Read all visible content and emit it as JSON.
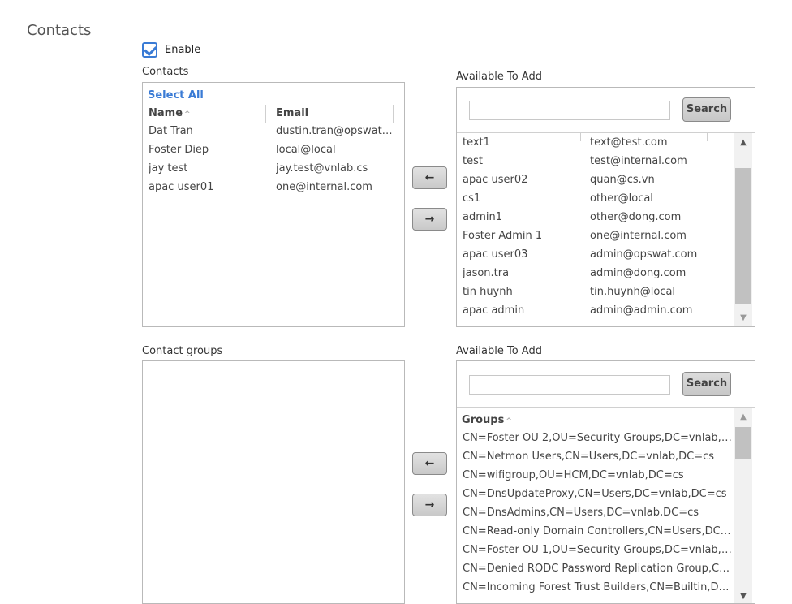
{
  "page": {
    "title": "Contacts"
  },
  "enable": {
    "label": "Enable",
    "checked": true
  },
  "contacts": {
    "label": "Contacts",
    "select_all": "Select All",
    "columns": {
      "name": "Name",
      "email": "Email"
    },
    "sort_icon": "sort-asc-icon",
    "rows": [
      {
        "name": "Dat Tran",
        "email": "dustin.tran@opswat...."
      },
      {
        "name": "Foster Diep",
        "email": "local@local"
      },
      {
        "name": "jay test",
        "email": "jay.test@vnlab.cs"
      },
      {
        "name": "apac user01",
        "email": "one@internal.com"
      }
    ]
  },
  "available_contacts": {
    "label": "Available To Add",
    "search_placeholder": "",
    "search_button": "Search",
    "rows": [
      {
        "name": "text1",
        "email": "text@test.com"
      },
      {
        "name": "test",
        "email": "test@internal.com"
      },
      {
        "name": "apac user02",
        "email": "quan@cs.vn"
      },
      {
        "name": "cs1",
        "email": "other@local"
      },
      {
        "name": "admin1",
        "email": "other@dong.com"
      },
      {
        "name": "Foster Admin 1",
        "email": "one@internal.com"
      },
      {
        "name": "apac user03",
        "email": "admin@opswat.com"
      },
      {
        "name": "jason.tra",
        "email": "admin@dong.com"
      },
      {
        "name": "tin huynh",
        "email": "tin.huynh@local"
      },
      {
        "name": "apac admin",
        "email": "admin@admin.com"
      }
    ]
  },
  "transfer_buttons": {
    "left": "←",
    "right": "→"
  },
  "contact_groups": {
    "label": "Contact groups"
  },
  "available_groups": {
    "label": "Available To Add",
    "search_placeholder": "",
    "search_button": "Search",
    "column": "Groups",
    "rows": [
      "CN=Foster OU 2,OU=Security Groups,DC=vnlab,D...",
      "CN=Netmon Users,CN=Users,DC=vnlab,DC=cs",
      "CN=wifigroup,OU=HCM,DC=vnlab,DC=cs",
      "CN=DnsUpdateProxy,CN=Users,DC=vnlab,DC=cs",
      "CN=DnsAdmins,CN=Users,DC=vnlab,DC=cs",
      "CN=Read-only Domain Controllers,CN=Users,DC=...",
      "CN=Foster OU 1,OU=Security Groups,DC=vnlab,DC...",
      "CN=Denied RODC Password Replication Group,CN...",
      "CN=Incoming Forest Trust Builders,CN=Builtin,DC..."
    ]
  },
  "colors": {
    "accent": "#3a7bd5",
    "border": "#b9b9b9"
  }
}
